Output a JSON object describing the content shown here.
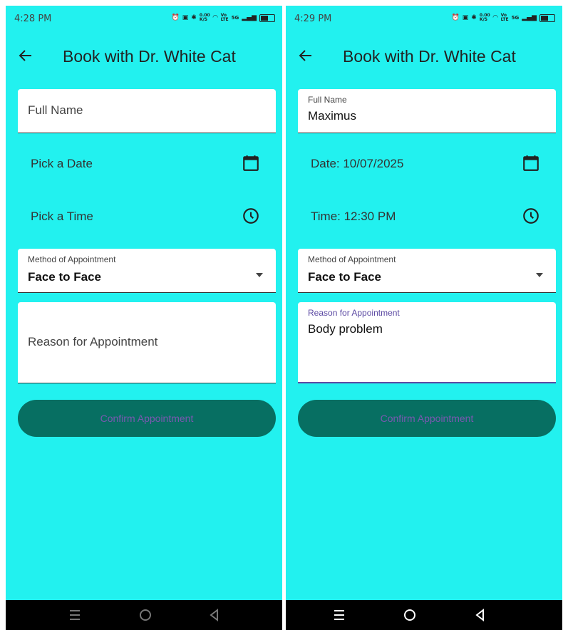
{
  "left": {
    "status": {
      "time": "4:28 PM",
      "net_speed": "0.00\nK/S",
      "volte": "Vo\nLTE",
      "signal": "5G"
    },
    "title": "Book with Dr. White Cat",
    "full_name": {
      "placeholder": "Full Name"
    },
    "date": {
      "label": "Pick a Date"
    },
    "time": {
      "label": "Pick a Time"
    },
    "method": {
      "label": "Method of Appointment",
      "value": "Face to Face"
    },
    "reason": {
      "placeholder": "Reason for Appointment"
    },
    "confirm_label": "Confirm Appointment"
  },
  "right": {
    "status": {
      "time": "4:29 PM",
      "net_speed": "0.00\nK/S",
      "volte": "Vo\nLTE",
      "signal": "5G"
    },
    "title": "Book with Dr. White Cat",
    "full_name": {
      "label": "Full Name",
      "value": "Maximus"
    },
    "date": {
      "label": "Date: 10/07/2025"
    },
    "time": {
      "label": "Time: 12:30 PM"
    },
    "method": {
      "label": "Method of Appointment",
      "value": "Face to Face"
    },
    "reason": {
      "label": "Reason for Appointment",
      "value": "Body problem"
    },
    "confirm_label": "Confirm Appointment"
  },
  "icons": {
    "back": "arrow-left-icon",
    "calendar": "calendar-icon",
    "clock": "clock-icon",
    "dropdown": "caret-down-icon",
    "nav_menu": "menu-icon",
    "nav_home": "home-circle-icon",
    "nav_back": "triangle-back-icon"
  },
  "colors": {
    "background": "#22f1ef",
    "button": "#076f62",
    "button_text": "#7a58b0",
    "focus_accent": "#5c4aa3"
  }
}
